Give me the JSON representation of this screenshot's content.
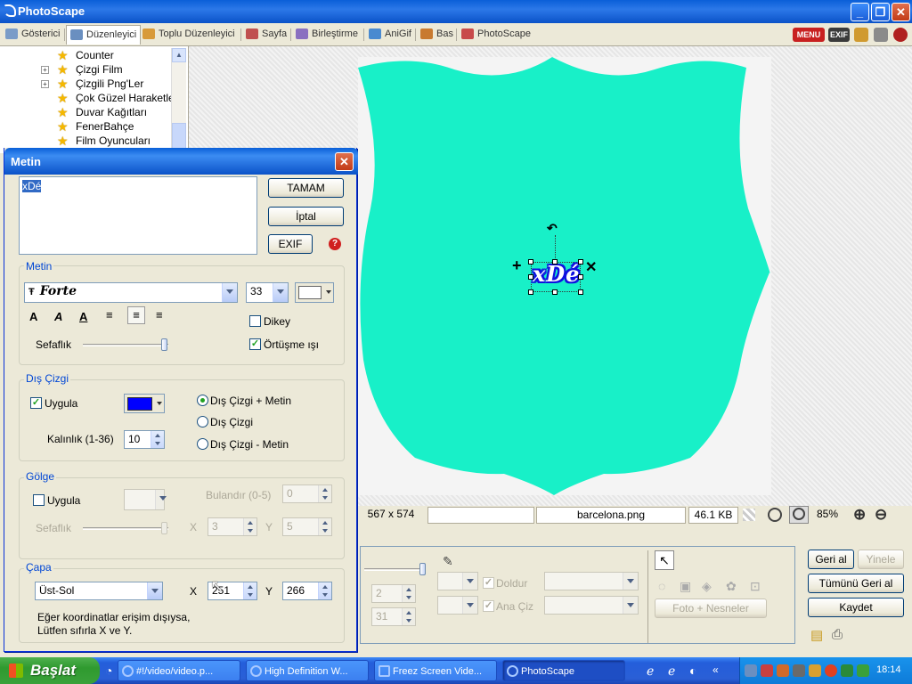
{
  "window": {
    "title": "PhotoScape",
    "minimize": "_",
    "maximize": "❐",
    "close": "✕"
  },
  "tabs": [
    {
      "label": "Gösterici"
    },
    {
      "label": "Düzenleyici",
      "active": true
    },
    {
      "label": "Toplu Düzenleyici"
    },
    {
      "label": "Sayfa"
    },
    {
      "label": "Birleştirme"
    },
    {
      "label": "AniGif"
    },
    {
      "label": "Bas"
    },
    {
      "label": "PhotoScape"
    }
  ],
  "top_icons": {
    "menu": "MENU",
    "exif": "EXIF"
  },
  "tree": {
    "items": [
      {
        "label": "Counter",
        "expandable": false
      },
      {
        "label": "Çizgi Film",
        "expandable": true
      },
      {
        "label": "Çizgili Png'Ler",
        "expandable": true
      },
      {
        "label": "Çok Güzel Haraketle",
        "expandable": false
      },
      {
        "label": "Duvar Kağıtları",
        "expandable": false
      },
      {
        "label": "FenerBahçe",
        "expandable": false
      },
      {
        "label": "Film Oyuncuları",
        "expandable": false
      }
    ]
  },
  "canvas": {
    "shape_color": "#18f0c8",
    "overlay_text": "xDé",
    "text_color": "#ffffff",
    "outline_color": "#1010e0"
  },
  "status": {
    "dimensions": "567 x 574",
    "filename": "barcelona.png",
    "filesize": "46.1 KB",
    "zoom": "85%"
  },
  "bottom_panel": {
    "fill_label": "Doldur",
    "outline_label": "Ana Çiz",
    "spin1": "2",
    "spin2": "31",
    "photo_objects": "Foto + Nesneler"
  },
  "right_buttons": {
    "undo": "Geri al",
    "redo": "Yinele",
    "undo_all": "Tümünü Geri al",
    "save": "Kaydet"
  },
  "dialog": {
    "title": "Metin",
    "text_value": "xDé",
    "ok": "TAMAM",
    "cancel": "İptal",
    "exif": "EXIF",
    "text_group": {
      "title": "Metin",
      "font": "Forte",
      "font_size": "33",
      "vertical_label": "Dikey",
      "vertical_checked": false,
      "antialias_label": "Örtüşme ışı",
      "antialias_checked": true,
      "opacity_label": "Sefaflık",
      "bold_glyph": "A",
      "italic_glyph": "A",
      "underline_glyph": "A"
    },
    "outline_group": {
      "title": "Dış Çizgi",
      "apply_label": "Uygula",
      "apply_checked": true,
      "color": "#0000ff",
      "thickness_label": "Kalınlık (1-36)",
      "thickness": "10",
      "opt1": "Dış Çizgi + Metin",
      "opt2": "Dış Çizgi",
      "opt3": "Dış Çizgi - Metin",
      "selected": 1
    },
    "shadow_group": {
      "title": "Gölge",
      "apply_label": "Uygula",
      "apply_checked": false,
      "blur_label": "Bulandır (0-5)",
      "blur": "0",
      "opacity_label": "Sefaflık",
      "x_label": "X",
      "x": "3",
      "y_label": "Y",
      "y": "5"
    },
    "anchor_group": {
      "title": "Çapa",
      "position": "Üst-Sol",
      "x_label": "X",
      "x": "251",
      "y_label": "Y",
      "y": "266",
      "note1": "Eğer koordinatlar erişim dışıysa,",
      "note2": "Lütfen sıfırla X ve Y."
    }
  },
  "taskbar": {
    "start": "Başlat",
    "tasks": [
      {
        "label": "#!/video/video.p..."
      },
      {
        "label": "High Definition W..."
      },
      {
        "label": "Freez Screen Vide..."
      },
      {
        "label": "PhotoScape",
        "active": true
      }
    ],
    "clock": "18:14"
  }
}
